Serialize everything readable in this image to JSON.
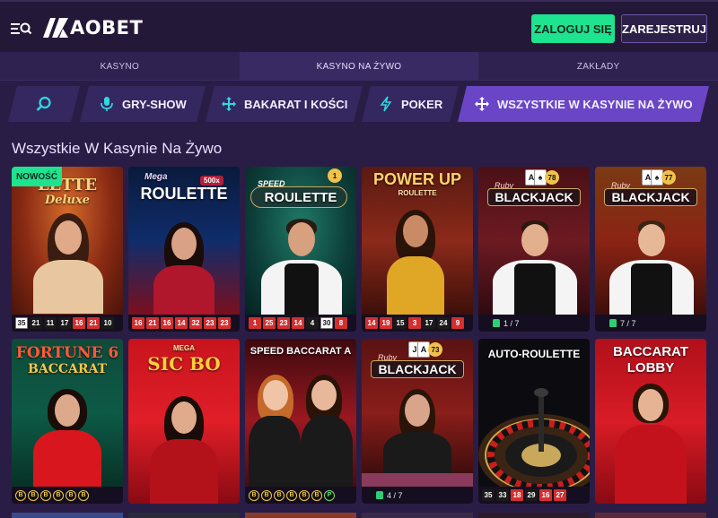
{
  "header": {
    "logo_text": "AOBET",
    "login_label": "ZALOGUJ SIĘ",
    "register_label": "ZAREJESTRUJ"
  },
  "tabs": [
    {
      "label": "KASYNO",
      "active": false
    },
    {
      "label": "KASYNO NA ŻYWO",
      "active": true
    },
    {
      "label": "ZAKŁADY",
      "active": false
    }
  ],
  "categories": [
    {
      "label": "",
      "icon": "search-icon"
    },
    {
      "label": "GRY-SHOW",
      "icon": "microphone-icon"
    },
    {
      "label": "BAKARAT I KOŚCI",
      "icon": "move-arrows-icon"
    },
    {
      "label": "POKER",
      "icon": "lightning-icon"
    },
    {
      "label": "WSZYSTKIE W KASYNIE NA ŻYWO",
      "icon": "move-arrows-icon",
      "active": true
    }
  ],
  "section_title": "Wszystkie W Kasynie Na Żywo",
  "games": [
    {
      "title": "LETTE",
      "subtitle": "Deluxe",
      "badge": "NOWOŚĆ",
      "results": [
        "35",
        "21",
        "11",
        "17",
        "16",
        "21",
        "10"
      ]
    },
    {
      "title": "ROULETTE",
      "subtitle": "Mega",
      "multiplier": "500x",
      "results": [
        "16",
        "21",
        "16",
        "14",
        "32",
        "23",
        "23"
      ]
    },
    {
      "title": "ROULETTE",
      "subtitle": "SPEED",
      "round": "1",
      "results": [
        "1",
        "25",
        "23",
        "14",
        "4",
        "30",
        "8"
      ]
    },
    {
      "title": "POWER UP",
      "subtitle": "ROULETTE",
      "results": [
        "14",
        "19",
        "15",
        "3",
        "17",
        "24",
        "9"
      ]
    },
    {
      "title": "BLACKJACK",
      "subtitle": "Ruby",
      "round": "78",
      "seats": "1 / 7"
    },
    {
      "title": "BLACKJACK",
      "subtitle": "Ruby",
      "round": "77",
      "seats": "7 / 7"
    },
    {
      "title": "FORTUNE 6",
      "subtitle": "BACCARAT",
      "beads": [
        "B",
        "B",
        "B",
        "B",
        "B",
        "B"
      ]
    },
    {
      "title": "SIC BO",
      "subtitle": "MEGA"
    },
    {
      "title": "SPEED BACCARAT A",
      "beads": [
        "B",
        "B",
        "B",
        "B",
        "B",
        "B",
        "P"
      ]
    },
    {
      "title": "BLACKJACK",
      "subtitle": "Ruby",
      "round": "73",
      "seats": "4 / 7"
    },
    {
      "title": "AUTO-ROULETTE",
      "results": [
        "35",
        "33",
        "18",
        "29",
        "16",
        "27"
      ]
    },
    {
      "title": "BACCARAT",
      "subtitle": "LOBBY"
    }
  ],
  "colors": {
    "accent_green": "#1ee38f",
    "accent_purple": "#6a46c6",
    "background": "#2a1d45",
    "roulette_red": "#d32f2f"
  }
}
